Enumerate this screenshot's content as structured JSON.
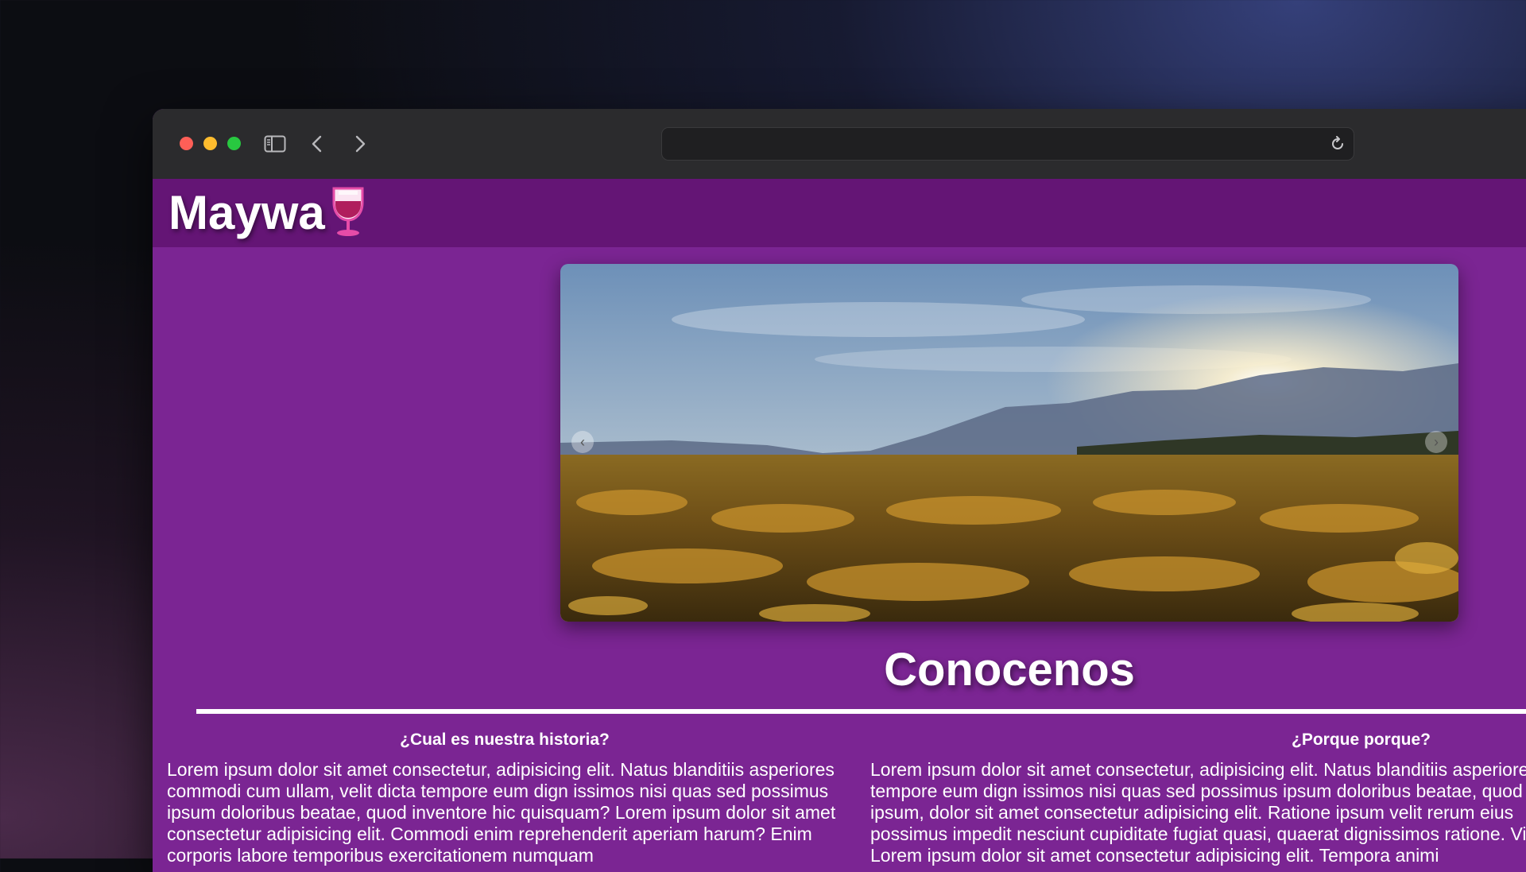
{
  "browser": {
    "address": "",
    "icons": [
      "sidebar-icon",
      "chevron-left-icon",
      "chevron-right-icon",
      "reload-icon"
    ]
  },
  "site": {
    "brand": "Maywa",
    "brand_icon": "wine-glass-icon",
    "colors": {
      "header": "#641575",
      "page": "#7b2593"
    }
  },
  "carousel": {
    "image_alt": "Vineyard at sunset",
    "prev_icon": "chevron-left-icon",
    "next_icon": "chevron-right-icon"
  },
  "main": {
    "section_title": "Conocenos",
    "columns": [
      {
        "heading": "¿Cual es nuestra historia?",
        "body": "Lorem ipsum dolor sit amet consectetur, adipisicing elit. Natus blanditiis asperiores commodi cum ullam, velit dicta tempore eum dign issimos nisi quas sed possimus ipsum doloribus beatae, quod inventore hic quisquam? Lorem ipsum dolor sit amet consectetur adipisicing elit. Commodi enim reprehenderit aperiam harum? Enim corporis labore temporibus exercitationem numquam"
      },
      {
        "heading": "¿Porque porque?",
        "body": "Lorem ipsum dolor sit amet consectetur, adipisicing elit. Natus blanditiis asperiores tempore eum dign issimos nisi quas sed possimus ipsum doloribus beatae, quod ipsum, dolor sit amet consectetur adipisicing elit. Ratione ipsum velit rerum eius possimus impedit nesciunt cupiditate fugiat quasi, quaerat dignissimos ratione. Vitae. Lorem ipsum dolor sit amet consectetur adipisicing elit. Tempora animi"
      }
    ]
  }
}
